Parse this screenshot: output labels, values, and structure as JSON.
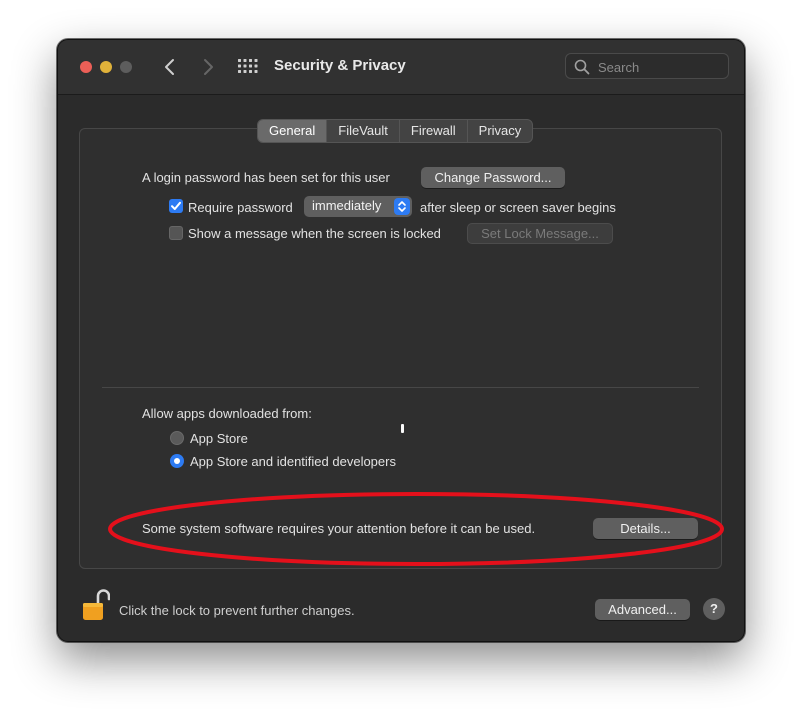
{
  "window": {
    "title": "Security & Privacy"
  },
  "search": {
    "placeholder": "Search"
  },
  "tabs": [
    {
      "label": "General",
      "selected": true
    },
    {
      "label": "FileVault",
      "selected": false
    },
    {
      "label": "Firewall",
      "selected": false
    },
    {
      "label": "Privacy",
      "selected": false
    }
  ],
  "general": {
    "login_text": "A login password has been set for this user",
    "change_password_label": "Change Password...",
    "require_password": {
      "label": "Require password",
      "checked": true,
      "value": "immediately",
      "suffix": "after sleep or screen saver begins"
    },
    "show_message": {
      "label": "Show a message when the screen is locked",
      "checked": false,
      "button_label": "Set Lock Message..."
    },
    "allow_apps": {
      "heading": "Allow apps downloaded from:",
      "options": [
        {
          "label": "App Store",
          "selected": false
        },
        {
          "label": "App Store and identified developers",
          "selected": true
        }
      ]
    },
    "attention": {
      "text": "Some system software requires your attention before it can be used.",
      "details_label": "Details..."
    }
  },
  "footer": {
    "lock_text": "Click the lock to prevent further changes.",
    "advanced_label": "Advanced...",
    "help_label": "?"
  },
  "icons": {
    "back": "chevron-left-icon",
    "forward": "chevron-right-icon",
    "show_all": "grid-icon",
    "search": "search-icon",
    "lock": "unlocked-padlock-icon",
    "select_arrows": "up-down-chevron-icon"
  },
  "colors": {
    "accent": "#2d7bf3",
    "annotation": "#e4101b",
    "close": "#ec5f57",
    "minimize": "#e0b23a",
    "lock": "#f0a020"
  }
}
